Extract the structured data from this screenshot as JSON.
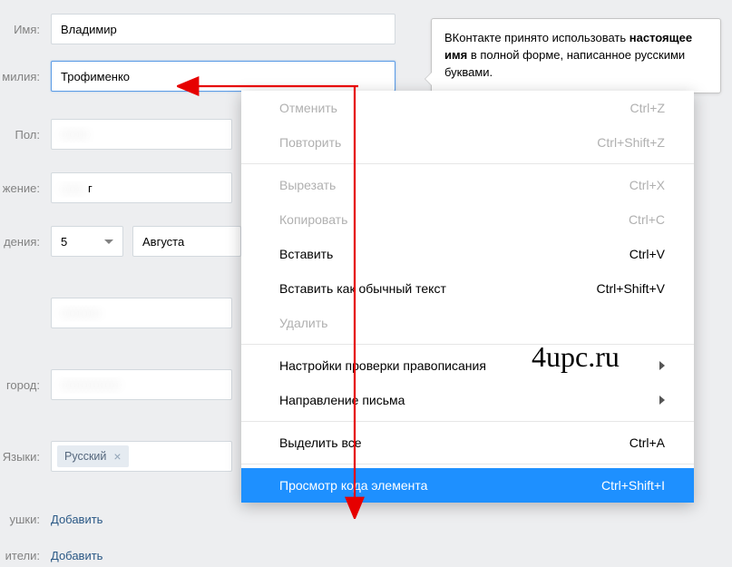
{
  "form": {
    "name_label": "Имя:",
    "name_value": "Владимир",
    "surname_label": "милия:",
    "surname_value": "Трофименко",
    "gender_label": "Пол:",
    "gender_value": "",
    "status_label": "жение:",
    "status_suffix": "г",
    "birth_label": "дения:",
    "day_value": "5",
    "month_value": "Августа",
    "city_label": "город:",
    "lang_label": "Языки:",
    "lang_tag": "Русский",
    "grandma_label": "ушки:",
    "grandma_action": "Добавить",
    "parents_label": "ители:",
    "parents_action": "Добавить"
  },
  "tooltip": {
    "line1": "ВКонтакте принято использовать ",
    "bold": "настоящее имя",
    "line2": " в полной форме, написанное русскими буквами."
  },
  "context_menu": {
    "items": [
      {
        "label": "Отменить",
        "shortcut": "Ctrl+Z",
        "disabled": true
      },
      {
        "label": "Повторить",
        "shortcut": "Ctrl+Shift+Z",
        "disabled": true
      }
    ],
    "items2": [
      {
        "label": "Вырезать",
        "shortcut": "Ctrl+X",
        "disabled": true
      },
      {
        "label": "Копировать",
        "shortcut": "Ctrl+C",
        "disabled": true
      },
      {
        "label": "Вставить",
        "shortcut": "Ctrl+V",
        "disabled": false
      },
      {
        "label": "Вставить как обычный текст",
        "shortcut": "Ctrl+Shift+V",
        "disabled": false
      },
      {
        "label": "Удалить",
        "shortcut": "",
        "disabled": true
      }
    ],
    "items3": [
      {
        "label": "Настройки проверки правописания",
        "submenu": true
      },
      {
        "label": "Направление письма",
        "submenu": true
      }
    ],
    "items4": [
      {
        "label": "Выделить все",
        "shortcut": "Ctrl+A",
        "disabled": false
      }
    ],
    "items5": [
      {
        "label": "Просмотр кода элемента",
        "shortcut": "Ctrl+Shift+I",
        "highlighted": true
      }
    ]
  },
  "watermark": "4upc.ru"
}
